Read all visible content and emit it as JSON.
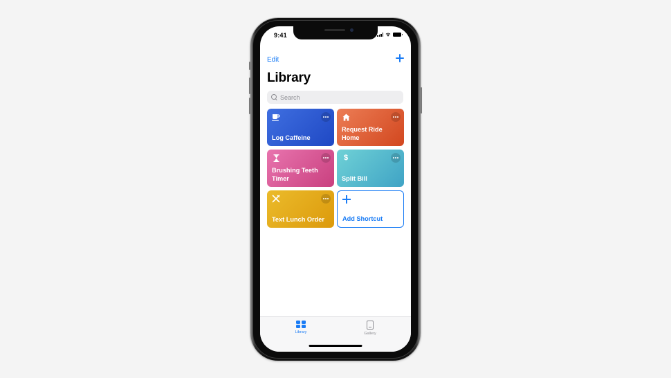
{
  "status_bar": {
    "time": "9:41"
  },
  "nav": {
    "edit_label": "Edit",
    "add_icon": "plus-icon"
  },
  "title": "Library",
  "search": {
    "placeholder": "Search",
    "value": ""
  },
  "shortcuts": [
    {
      "label": "Log Caffeine",
      "icon": "coffee-cup-icon",
      "glyph": "☕",
      "gradient": [
        "#3f6fe0",
        "#1f48c4"
      ]
    },
    {
      "label": "Request Ride Home",
      "icon": "house-icon",
      "glyph": "⌂",
      "gradient": [
        "#ec7d55",
        "#d2471f"
      ]
    },
    {
      "label": "Brushing Teeth Timer",
      "icon": "hourglass-icon",
      "glyph": "⧗",
      "gradient": [
        "#e874ae",
        "#c9407f"
      ]
    },
    {
      "label": "Split Bill",
      "icon": "dollar-icon",
      "glyph": "$",
      "gradient": [
        "#6fd1d6",
        "#3fa3c5"
      ]
    },
    {
      "label": "Text Lunch Order",
      "icon": "fork-knife-icon",
      "glyph": "✕",
      "gradient": [
        "#ebbb2b",
        "#dc9a0c"
      ]
    }
  ],
  "add_shortcut": {
    "label": "Add Shortcut",
    "color": "#1a7cf5"
  },
  "tab_bar": {
    "tabs": [
      {
        "label": "Library",
        "icon": "library-grid-icon",
        "active": true
      },
      {
        "label": "Gallery",
        "icon": "gallery-icon",
        "active": false
      }
    ]
  },
  "colors": {
    "accent": "#1a7cf5",
    "background": "#f4f4f4"
  }
}
